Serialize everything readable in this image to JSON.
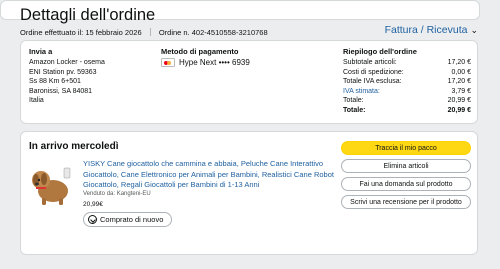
{
  "header": {
    "title": "Dettagli dell'ordine",
    "order_date": "Ordine effettuato il: 15 febbraio 2026",
    "order_number": "Ordine n. 402-4510558-3210768",
    "invoice_link": "Fattura / Ricevuta"
  },
  "shipping": {
    "title": "Invia a",
    "lines": [
      "Amazon Locker - osema",
      "ENI Station pv. 59363",
      "Ss 88 Km 6+501",
      "Baronissi, SA 84081",
      "Italia"
    ]
  },
  "payment": {
    "title": "Metodo di pagamento",
    "method": "Hype Next •••• 6939"
  },
  "summary": {
    "title": "Riepilogo dell'ordine",
    "rows": [
      {
        "label": "Subtotale articoli:",
        "value": "17,20 €"
      },
      {
        "label": "Costi di spedizione:",
        "value": "0,00 €"
      },
      {
        "label": "Totale IVA esclusa:",
        "value": "17,20 €"
      },
      {
        "label": "IVA stimata:",
        "value": "3,79 €"
      },
      {
        "label": "Totale:",
        "value": "20,99 €"
      },
      {
        "label": "Totale:",
        "value": "20,99 €"
      }
    ]
  },
  "arrival": {
    "title": "In arrivo mercoledì",
    "product_title": "YISKY Cane giocattolo che cammina e abbaia, Peluche Cane Interattivo Giocattolo, Cane Elettronico per Animali per Bambini, Realistici Cane Robot Giocattolo, Regali Giocattoli per Bambini di 1-13 Anni",
    "seller": "Venduto da: Kangteni-EU",
    "price": "20,99€",
    "rebuy_label": "Comprato di nuovo"
  },
  "actions": {
    "track": "Traccia il mio pacco",
    "delete": "Elimina articoli",
    "question": "Fai una domanda sul prodotto",
    "review": "Scrivi una recensione per il prodotto"
  },
  "colors": {
    "link": "#2162a1",
    "primary_button": "#ffd814",
    "background": "#ebedef"
  }
}
